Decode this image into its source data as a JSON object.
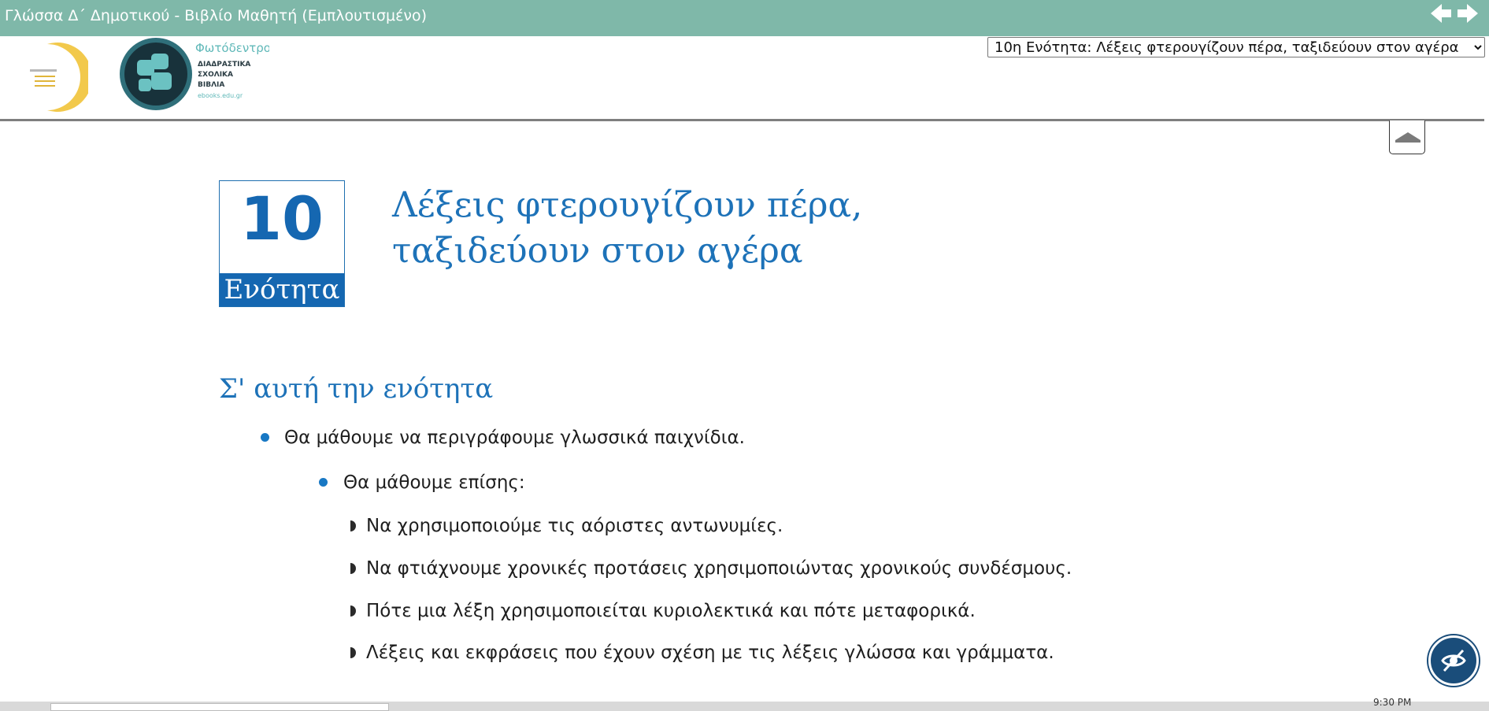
{
  "window": {
    "title": "Γλώσσα Δ΄ Δημοτικού - Βιβλίο Μαθητή (Εμπλουτισμένο)"
  },
  "header": {
    "logo_photodentro_name": "Φωτόδεντρο",
    "logo_photodentro_lines": [
      "ΔΙΑΔΡΑΣΤΙΚΑ",
      "ΣΧΟΛΙΚΑ",
      "ΒΙΒΛΙΑ"
    ],
    "logo_photodentro_url": "ebooks.edu.gr",
    "unit_select": {
      "selected": "10η Ενότητα: Λέξεις φτερουγίζουν πέρα, ταξιδεύουν στον αγέρα"
    }
  },
  "unit": {
    "number": "10",
    "label": "Ενότητα",
    "title_line1": "Λέξεις φτερουγίζουν πέρα,",
    "title_line2": "ταξιδεύουν στον αγέρα"
  },
  "section": {
    "heading": "Σ' αυτή την ενότητα",
    "bullet1": "Θα μάθουμε να περιγράφουμε γλωσσικά παιχνίδια.",
    "bullet2": "Θα μάθουμε επίσης:",
    "subitems": [
      "Να χρησιμοποιούμε τις αόριστες αντωνυμίες.",
      "Να φτιάχνουμε χρονικές προτάσεις χρησιμοποιώντας χρονικούς συνδέσμους.",
      "Πότε μια λέξη χρησιμοποιείται κυριολεκτικά και πότε μεταφορικά.",
      "Λέξεις και εκφράσεις που έχουν σχέση με τις λέξεις γλώσσα και γράμματα."
    ]
  },
  "taskbar": {
    "clock": "9:30 PM"
  },
  "colors": {
    "topbar": "#7fb8a9",
    "accent_blue": "#1567b1",
    "heading_blue": "#1d72b8"
  },
  "icons": {
    "prev": "arrow-left-icon",
    "next": "arrow-right-icon",
    "collapse": "chevron-up-icon",
    "accessibility": "eye-slash-icon"
  }
}
